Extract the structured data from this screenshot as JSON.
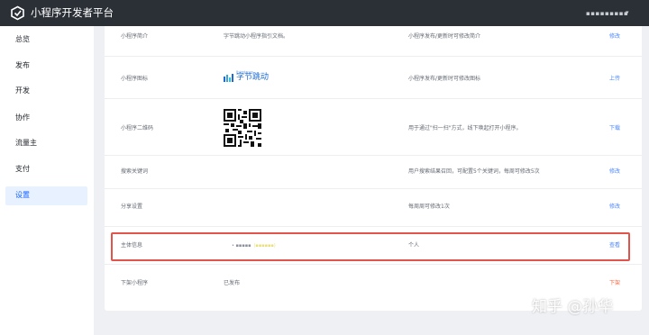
{
  "app": {
    "title": "小程序开发者平台",
    "account": "▪▪▪▪▪▪▪▪▪",
    "account_caret": "▾"
  },
  "sidebar": {
    "items": [
      {
        "label": "总览",
        "active": false
      },
      {
        "label": "发布",
        "active": false
      },
      {
        "label": "开发",
        "active": false
      },
      {
        "label": "协作",
        "active": false
      },
      {
        "label": "流量主",
        "active": false
      },
      {
        "label": "支付",
        "active": false
      },
      {
        "label": "设置",
        "active": true
      }
    ]
  },
  "settings": {
    "rows": [
      {
        "label": "小程序简介",
        "value": "字节跳动小程序指引文档。",
        "desc": "小程序发布/更新时可修改简介",
        "action": "修改"
      },
      {
        "label": "小程序图标",
        "value": "",
        "desc": "小程序发布/更新时可修改图标",
        "action": "上传"
      },
      {
        "label": "小程序二维码",
        "value": "",
        "desc": "用于通过\"扫一扫\"方式，线下唤起打开小程序。",
        "action": "下载"
      },
      {
        "label": "搜索关键词",
        "value": "",
        "desc": "用户搜索结果召回，可配置5个关键词，每周可修改5次",
        "action": "修改"
      },
      {
        "label": "分享设置",
        "value": "",
        "desc": "每周周可修改1次",
        "action": "修改"
      },
      {
        "label": "主体信息",
        "value": "",
        "desc": "个人",
        "action": "查看"
      },
      {
        "label": "下架小程序",
        "value": "已发布",
        "desc": "",
        "action": "下架"
      }
    ],
    "brand_logo": {
      "en": "Bytedance",
      "cn": "字节跳动"
    },
    "masked_subject": {
      "prefix": "• ▪▪▪▪▪",
      "suffix": "(▪▪▪▪▪▪)"
    }
  },
  "watermark": "知乎 @孙华",
  "colors": {
    "topbar": "#2b2f36",
    "accent": "#1664ff",
    "action": "#4a87ff",
    "danger": "#f56a45",
    "highlight": "#e2534b"
  }
}
